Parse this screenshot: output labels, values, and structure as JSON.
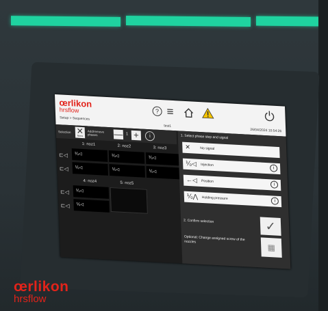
{
  "device": {
    "brand": "œrlikon",
    "sub": "hrsflow"
  },
  "screen": {
    "brand": "œrlikon",
    "sub": "hrsflow",
    "breadcrumb": "Setup > Sequences",
    "recipe": "test1",
    "datetime": "26/04/2024 10:54:26",
    "icons": [
      "help-icon",
      "menu-icon",
      "home-icon",
      "warning-icon",
      "power-icon"
    ],
    "accent": "#e2231a",
    "warning_color": "#f5c400"
  },
  "toolbar": {
    "selection_label": "Selection",
    "none_label": "None",
    "add_remove_label": "Add/remove phases",
    "minus": "—",
    "count": "1",
    "plus": "+",
    "info": "i"
  },
  "nozzles": {
    "row1_heads": [
      "1: noz1",
      "2: noz2",
      "3: noz3"
    ],
    "row2_heads": [
      "4: noz4",
      "5: noz5"
    ],
    "cell_text": "⅟₀◁"
  },
  "phase_panel": {
    "title": "1. Select phase step and signal",
    "options": [
      {
        "icon": "✕",
        "label": "No signal"
      },
      {
        "icon": "⅟₀◁",
        "label": "Injection"
      },
      {
        "icon": "←◁",
        "label": "Position"
      },
      {
        "icon": "⅟₀⋀",
        "label": "Holding pressure"
      }
    ],
    "confirm_label": "2. Confirm selection",
    "optional_label": "Optional: Change assigned screw of the nozzles",
    "check": "✓",
    "qr": "▦"
  }
}
